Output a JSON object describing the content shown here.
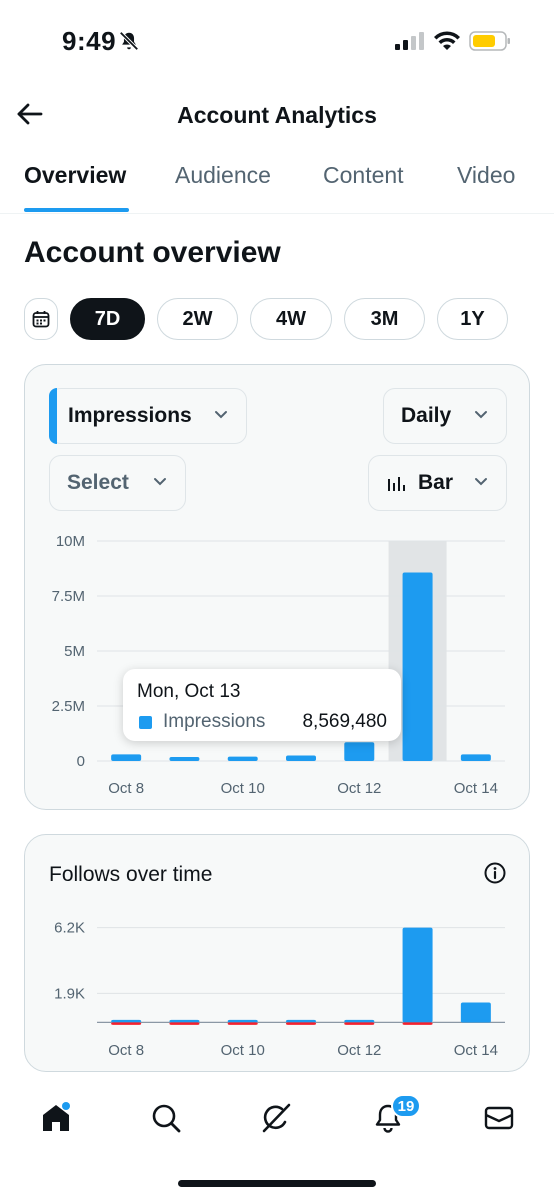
{
  "status_bar": {
    "time": "9:49"
  },
  "header": {
    "title": "Account Analytics",
    "back_icon": "arrow-left-icon"
  },
  "tabs": [
    {
      "label": "Overview",
      "active": true
    },
    {
      "label": "Audience",
      "active": false
    },
    {
      "label": "Content",
      "active": false
    },
    {
      "label": "Video",
      "active": false
    }
  ],
  "section_title": "Account overview",
  "range_pills": [
    "7D",
    "2W",
    "4W",
    "3M",
    "1Y"
  ],
  "range_selected": "7D",
  "impressions_card": {
    "metric_dropdown": "Impressions",
    "interval_dropdown": "Daily",
    "compare_dropdown": "Select",
    "chart_type_dropdown": "Bar",
    "tooltip": {
      "date": "Mon, Oct 13",
      "label": "Impressions",
      "value": "8,569,480"
    }
  },
  "follows_card": {
    "title": "Follows over time"
  },
  "bottom_nav": {
    "items": [
      "home-icon",
      "search-icon",
      "grok-icon",
      "notifications-icon",
      "messages-icon"
    ],
    "notification_count": "19"
  },
  "colors": {
    "accent": "#1d9bf0",
    "text": "#0f1419",
    "muted": "#536471",
    "negative": "#f4212e"
  },
  "chart_data": [
    {
      "type": "bar",
      "title": "",
      "categories": [
        "Oct 8",
        "Oct 9",
        "Oct 10",
        "Oct 11",
        "Oct 12",
        "Oct 13",
        "Oct 14"
      ],
      "x_tick_labels": [
        "Oct 8",
        "Oct 10",
        "Oct 12",
        "Oct 14"
      ],
      "series": [
        {
          "name": "Impressions",
          "values": [
            300000,
            150000,
            200000,
            250000,
            850000,
            8569480,
            300000
          ]
        }
      ],
      "y_tick_labels": [
        "0",
        "2.5M",
        "5M",
        "7.5M",
        "10M"
      ],
      "y_ticks": [
        0,
        2500000,
        5000000,
        7500000,
        10000000
      ],
      "ylim": [
        0,
        10000000
      ],
      "highlighted_category": "Oct 13",
      "grid": true
    },
    {
      "type": "bar",
      "title": "Follows over time",
      "categories": [
        "Oct 8",
        "Oct 9",
        "Oct 10",
        "Oct 11",
        "Oct 12",
        "Oct 13",
        "Oct 14"
      ],
      "x_tick_labels": [
        "Oct 8",
        "Oct 10",
        "Oct 12",
        "Oct 14"
      ],
      "series": [
        {
          "values": [
            40,
            40,
            20,
            20,
            40,
            6200,
            1300
          ]
        },
        {
          "values": [
            -20,
            -20,
            -20,
            -40,
            -20,
            -60,
            0
          ]
        }
      ],
      "y_tick_labels": [
        "1.9K",
        "6.2K"
      ],
      "y_ticks": [
        1900,
        6200
      ],
      "ylim": [
        -300,
        6500
      ],
      "grid": true
    }
  ]
}
